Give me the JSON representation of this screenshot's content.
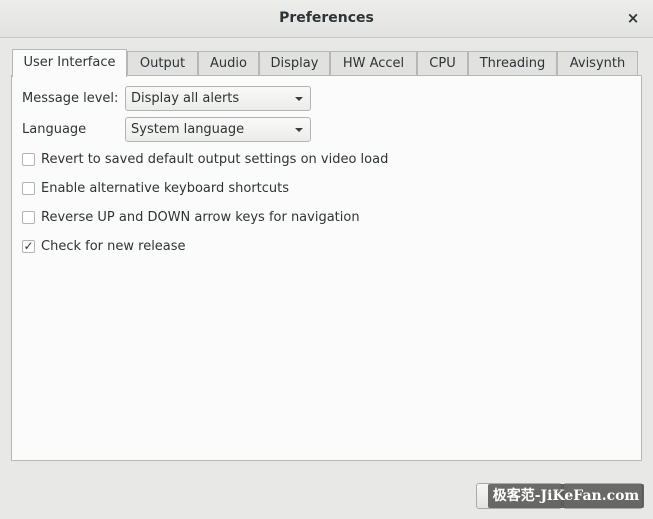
{
  "window": {
    "title": "Preferences",
    "close_glyph": "×"
  },
  "tabs": [
    {
      "label": "User Interface",
      "active": true
    },
    {
      "label": "Output",
      "active": false
    },
    {
      "label": "Audio",
      "active": false
    },
    {
      "label": "Display",
      "active": false
    },
    {
      "label": "HW Accel",
      "active": false
    },
    {
      "label": "CPU",
      "active": false
    },
    {
      "label": "Threading",
      "active": false
    },
    {
      "label": "Avisynth",
      "active": false
    }
  ],
  "user_interface": {
    "message_level": {
      "label": "Message level:",
      "value": "Display all alerts"
    },
    "language": {
      "label": "Language",
      "value": "System language"
    },
    "checkboxes": [
      {
        "label": "Revert to saved default output settings on video load",
        "checked": false
      },
      {
        "label": "Enable alternative keyboard shortcuts",
        "checked": false
      },
      {
        "label": "Reverse UP and DOWN arrow keys for navigation",
        "checked": false
      },
      {
        "label": "Check for new release",
        "checked": true
      }
    ]
  },
  "footer": {
    "watermark": "极客范-JiKeFan.com"
  },
  "colors": {
    "background": "#e8e8e7",
    "panel": "#fbfbfb",
    "border": "#b7b7b5",
    "text": "#2e3436"
  }
}
